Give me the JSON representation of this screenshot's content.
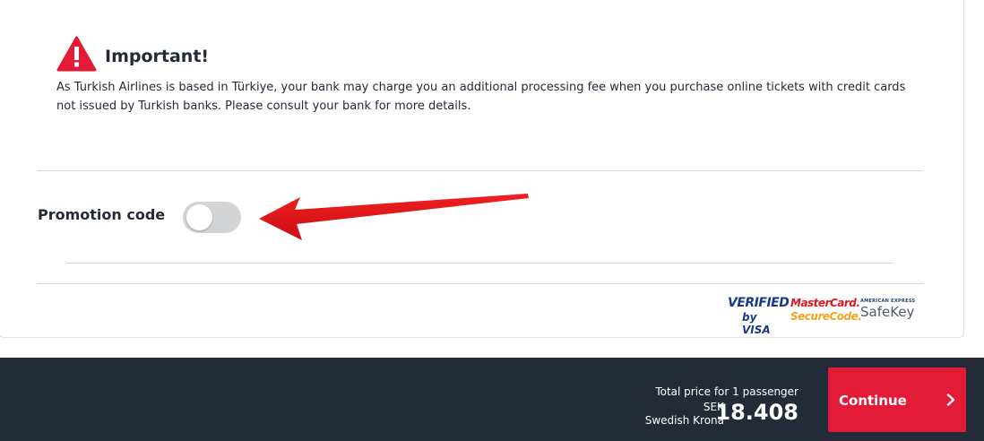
{
  "notice": {
    "icon": "warning-triangle-icon",
    "title": "Important!",
    "body": "As Turkish Airlines is based in Türkiye, your bank may charge you an additional processing fee when you purchase online tickets with credit cards not issued by Turkish banks. Please consult your bank for more details.",
    "icon_color": "#e31b37"
  },
  "promotion": {
    "label": "Promotion code",
    "toggle_on": false,
    "annotation_icon": "red-arrow-icon",
    "annotation_color": "#e8141c"
  },
  "security_logos": {
    "visa_line1": "VERIFIED",
    "visa_line2": "by VISA",
    "mastercard_line1": "MasterCard.",
    "mastercard_line2": "SecureCode.",
    "amex_line1": "AMERICAN EXPRESS",
    "amex_line2": "SafeKey"
  },
  "footer": {
    "total_label": "Total price for 1 passenger",
    "currency_code": "SEK",
    "currency_name": "Swedish Krona",
    "amount": "18.408",
    "continue_label": "Continue",
    "continue_icon": "chevron-right-icon",
    "background": "#232b38",
    "accent": "#e31b37"
  }
}
